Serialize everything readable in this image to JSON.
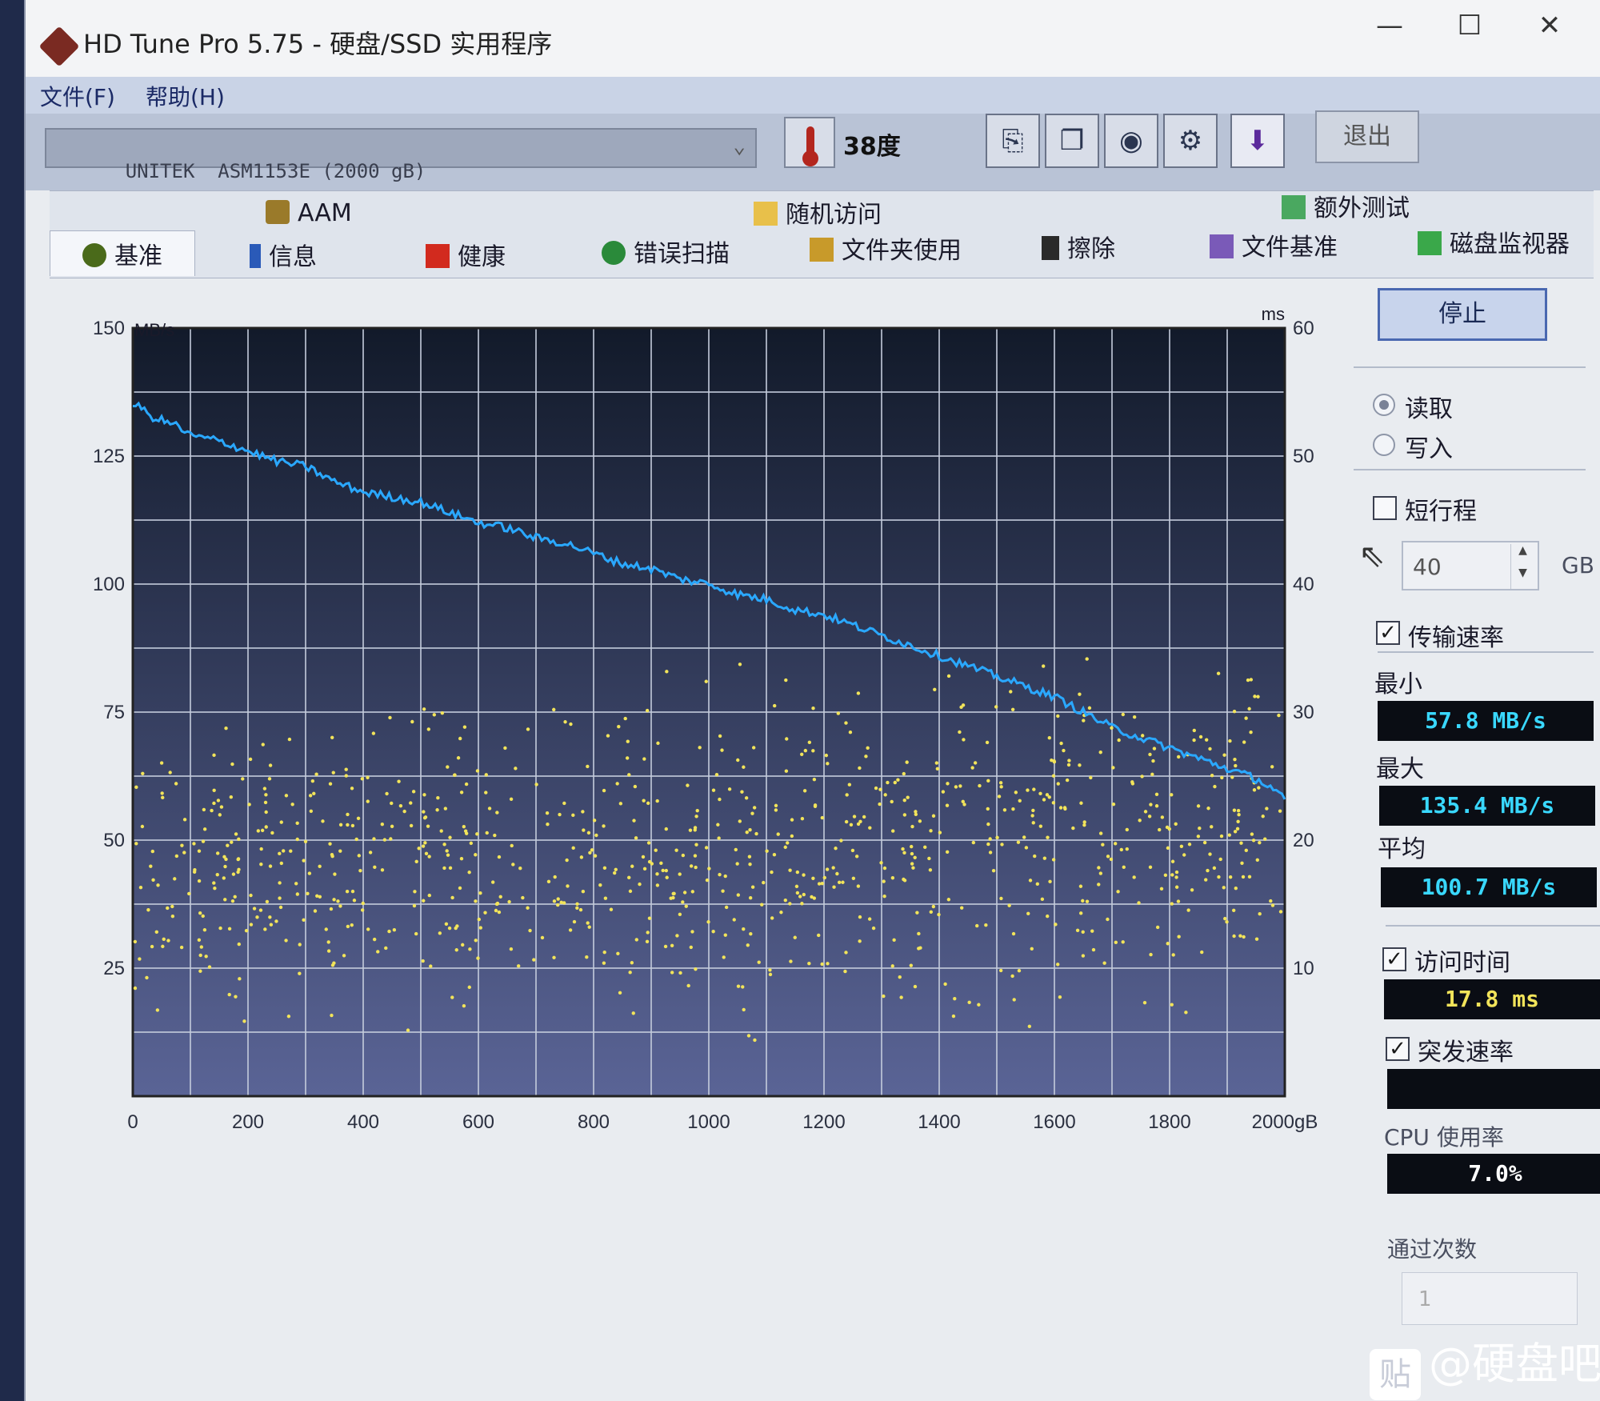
{
  "window": {
    "title": "HD Tune Pro 5.75 - 硬盘/SSD 实用程序",
    "minimize": "—",
    "maximize": "☐",
    "close": "✕"
  },
  "menu": {
    "file": "文件(F)",
    "help": "帮助(H)"
  },
  "toolbar": {
    "drive": "UNITEK  ASM1153E (2000 gB)",
    "temperature": "38度",
    "exit_label": "退出",
    "icons": [
      "copy-info-icon",
      "copy-all-icon",
      "camera-icon",
      "options-icon",
      "save-icon"
    ]
  },
  "tabs": {
    "top": [
      {
        "label": "AAM",
        "icon": "speaker-icon"
      },
      {
        "label": "随机访问",
        "icon": "random-access-icon"
      },
      {
        "label": "额外测试",
        "icon": "extra-tests-icon"
      }
    ],
    "bottom": [
      {
        "label": "基准",
        "icon": "benchmark-icon",
        "active": true
      },
      {
        "label": "信息",
        "icon": "info-icon"
      },
      {
        "label": "健康",
        "icon": "health-icon"
      },
      {
        "label": "错误扫描",
        "icon": "error-scan-icon"
      },
      {
        "label": "文件夹使用",
        "icon": "folder-icon"
      },
      {
        "label": "擦除",
        "icon": "erase-icon"
      },
      {
        "label": "文件基准",
        "icon": "file-benchmark-icon"
      },
      {
        "label": "磁盘监视器",
        "icon": "disk-monitor-icon"
      }
    ]
  },
  "panel": {
    "stop_label": "停止",
    "read_label": "读取",
    "write_label": "写入",
    "read_selected": true,
    "short_stroke_label": "短行程",
    "short_stroke_checked": false,
    "short_stroke_value": "40",
    "short_stroke_unit": "GB",
    "transfer_rate_label": "传输速率",
    "transfer_rate_checked": true,
    "min_label": "最小",
    "min_value": "57.8 MB/s",
    "max_label": "最大",
    "max_value": "135.4 MB/s",
    "avg_label": "平均",
    "avg_value": "100.7 MB/s",
    "access_time_label": "访问时间",
    "access_time_checked": true,
    "access_time_value": "17.8 ms",
    "burst_rate_label": "突发速率",
    "burst_rate_checked": true,
    "burst_rate_value": "",
    "cpu_label": "CPU 使用率",
    "cpu_value": "7.0%",
    "passes_label": "通过次数",
    "passes_value": "1"
  },
  "watermark": {
    "text": "@硬盘吧",
    "logo": "贴"
  },
  "colors": {
    "plot_bg_top": "#121a2a",
    "plot_bg_bottom": "#5a6496",
    "grid": "#c4ccdc",
    "transfer_line": "#2aa8ff",
    "access_points": "#f2e45a",
    "value_cyan": "#39d8ff",
    "value_yellow": "#f2e45a"
  },
  "chart_data": {
    "type": "line",
    "title": "",
    "ylabel_left": "MB/s",
    "ylabel_right": "ms",
    "xunit": "gB",
    "x_ticks": [
      0,
      200,
      400,
      600,
      800,
      1000,
      1200,
      1400,
      1600,
      1800,
      2000
    ],
    "x_tick_labels": [
      "0",
      "200",
      "400",
      "600",
      "800",
      "1000",
      "1200",
      "1400",
      "1600",
      "1800",
      "2000gB"
    ],
    "y_left_ticks": [
      25,
      50,
      75,
      100,
      125,
      150
    ],
    "y_right_ticks": [
      10,
      20,
      30,
      40,
      50,
      60
    ],
    "xlim": [
      0,
      2000
    ],
    "ylim_left": [
      0,
      150
    ],
    "ylim_right": [
      0,
      60
    ],
    "grid": true,
    "series": [
      {
        "axis": "left",
        "x": [
          0,
          10,
          25,
          50,
          75,
          100,
          150,
          200,
          250,
          300,
          350,
          400,
          450,
          500,
          550,
          600,
          650,
          700,
          750,
          800,
          850,
          900,
          950,
          1000,
          1050,
          1100,
          1150,
          1200,
          1250,
          1300,
          1350,
          1400,
          1450,
          1500,
          1550,
          1600,
          1650,
          1700,
          1750,
          1800,
          1850,
          1900,
          1950,
          1980,
          2000
        ],
        "y": [
          134,
          135.4,
          133,
          132,
          131,
          129,
          128,
          126,
          124,
          123,
          120,
          118,
          117,
          116,
          114,
          112,
          111,
          109,
          108,
          106,
          104,
          103,
          101,
          100,
          98,
          97,
          95,
          94,
          92,
          90,
          88,
          86,
          84,
          82,
          80,
          78,
          75,
          72,
          70,
          68,
          66,
          64,
          62,
          60,
          57.8
        ]
      }
    ],
    "access_time_ms": {
      "axis": "right",
      "mean": 17.8,
      "range_ms": [
        2,
        32
      ]
    }
  }
}
